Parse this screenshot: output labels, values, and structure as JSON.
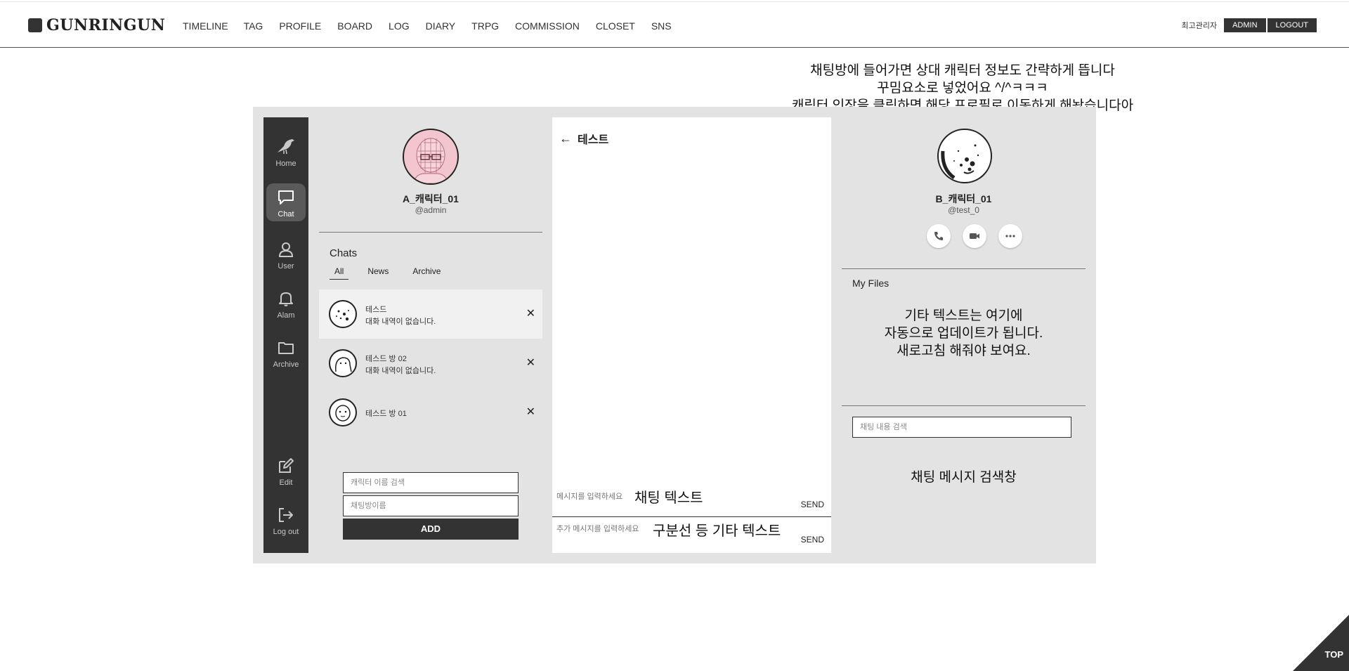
{
  "header": {
    "logo": "GUNRINGUN",
    "nav": [
      "TIMELINE",
      "TAG",
      "PROFILE",
      "BOARD",
      "LOG",
      "DIARY",
      "TRPG",
      "COMMISSION",
      "CLOSET",
      "SNS"
    ],
    "admin_label": "최고관리자",
    "admin_button": "ADMIN",
    "logout_button": "LOGOUT"
  },
  "annotations": {
    "top": [
      "채팅방에 들어가면 상대 캐릭터 정보도 간략하게 뜹니다",
      "꾸밈요소로 넣었어요 ^/^ㅋㅋㅋ",
      "캐릭터 인장을 클릭하면 해당 프로필로 이동하게 해놨습니다아"
    ],
    "chat_text": "채팅 텍스트",
    "divider_text": "구분선 등 기타 텍스트",
    "files_note": [
      "기타 텍스트는 여기에",
      "자동으로 업데이트가 됩니다.",
      "새로고침 해줘야 보여요."
    ],
    "search_note": "채팅 메시지 검색창"
  },
  "sidebar": {
    "items": [
      {
        "label": "Home",
        "icon": "bird-icon"
      },
      {
        "label": "Chat",
        "icon": "chat-bubble-icon",
        "active": true
      },
      {
        "label": "User",
        "icon": "user-icon"
      },
      {
        "label": "Alam",
        "icon": "bell-icon"
      },
      {
        "label": "Archive",
        "icon": "folder-icon"
      },
      {
        "label": "Edit",
        "icon": "edit-icon"
      },
      {
        "label": "Log out",
        "icon": "logout-icon"
      }
    ]
  },
  "profile": {
    "name": "A_캐릭터_01",
    "handle": "@admin",
    "chats_title": "Chats",
    "tabs": [
      "All",
      "News",
      "Archive"
    ],
    "chats": [
      {
        "name": "테스드",
        "message": "대화 내역이 없습니다."
      },
      {
        "name": "테스드 방 02",
        "message": "대화 내역이 없습니다."
      },
      {
        "name": "테스드 방 01",
        "message": ""
      }
    ],
    "character_search_placeholder": "캐릭터 이름 검색",
    "room_name_placeholder": "채팅방이름",
    "add_button": "ADD"
  },
  "chat": {
    "title": "테스트",
    "message_placeholder": "메시지를 입력하세요",
    "extra_placeholder": "추가 메시지를 입력하세요",
    "send_label": "SEND"
  },
  "info": {
    "name": "B_캐릭터_01",
    "handle": "@test_0",
    "my_files": "My Files",
    "search_placeholder": "채팅 내용 검색"
  },
  "top_button": "TOP"
}
